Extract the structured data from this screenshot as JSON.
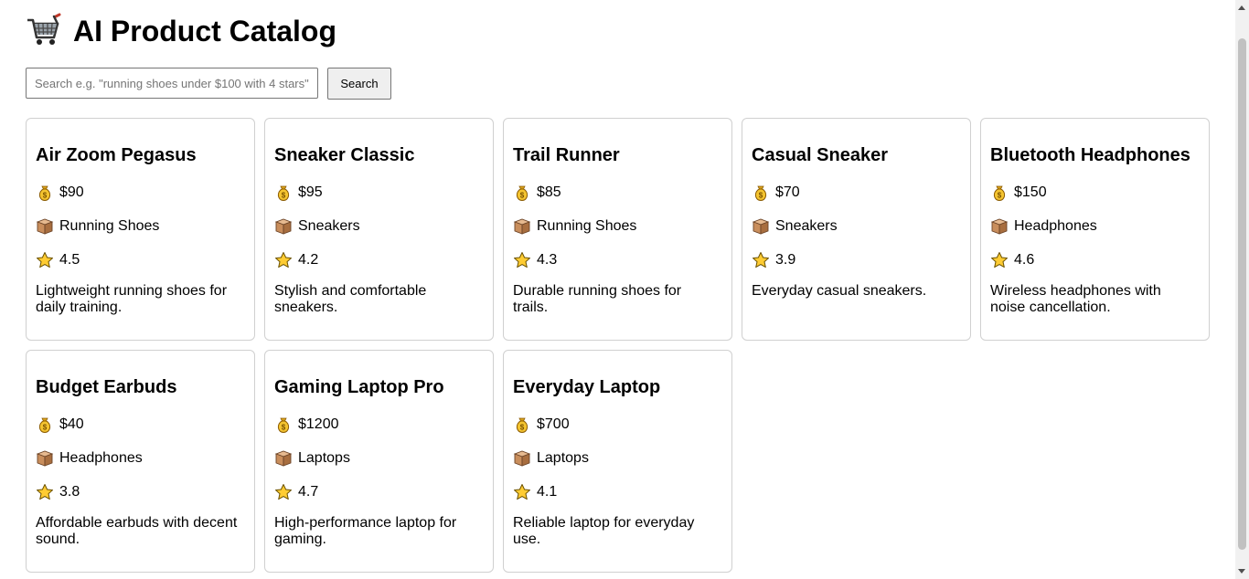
{
  "header": {
    "title": "AI Product Catalog",
    "icon": "shopping-cart-icon"
  },
  "search": {
    "placeholder": "Search e.g. \"running shoes under $100 with 4 stars\"",
    "value": "",
    "button_label": "Search"
  },
  "colors": {
    "card_border": "#d0d0d0",
    "button_bg": "#efefef",
    "scrollbar_thumb": "#c1c1c1"
  },
  "products": [
    {
      "name": "Air Zoom Pegasus",
      "price": "$90",
      "category": "Running Shoes",
      "rating": "4.5",
      "description": "Lightweight running shoes for daily training."
    },
    {
      "name": "Sneaker Classic",
      "price": "$95",
      "category": "Sneakers",
      "rating": "4.2",
      "description": "Stylish and comfortable sneakers."
    },
    {
      "name": "Trail Runner",
      "price": "$85",
      "category": "Running Shoes",
      "rating": "4.3",
      "description": "Durable running shoes for trails."
    },
    {
      "name": "Casual Sneaker",
      "price": "$70",
      "category": "Sneakers",
      "rating": "3.9",
      "description": "Everyday casual sneakers."
    },
    {
      "name": "Bluetooth Headphones",
      "price": "$150",
      "category": "Headphones",
      "rating": "4.6",
      "description": "Wireless headphones with noise cancellation."
    },
    {
      "name": "Budget Earbuds",
      "price": "$40",
      "category": "Headphones",
      "rating": "3.8",
      "description": "Affordable earbuds with decent sound."
    },
    {
      "name": "Gaming Laptop Pro",
      "price": "$1200",
      "category": "Laptops",
      "rating": "4.7",
      "description": "High-performance laptop for gaming."
    },
    {
      "name": "Everyday Laptop",
      "price": "$700",
      "category": "Laptops",
      "rating": "4.1",
      "description": "Reliable laptop for everyday use."
    }
  ]
}
